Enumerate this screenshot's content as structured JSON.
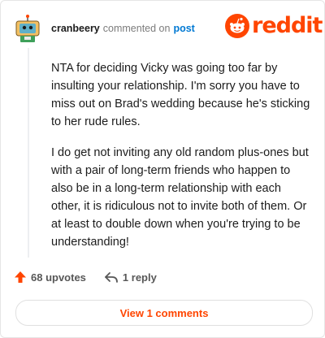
{
  "comment": {
    "username": "cranbeery",
    "action_text": "commented on",
    "post_link": "post",
    "paragraphs": [
      "NTA for deciding Vicky was going too far by insulting your relationship. I'm sorry you have to miss out on Brad's wedding because he's sticking to her rude rules.",
      "I do get not inviting any old random plus-ones but with a pair of long-term friends who happen to also be in a long-term relationship with each other, it is ridiculous not to invite both of them. Or at least to double down when you're trying to be understanding!"
    ]
  },
  "brand": {
    "name": "reddit",
    "color": "#ff4500"
  },
  "actions": {
    "upvotes": "68 upvotes",
    "reply": "1 reply",
    "view_comments": "View 1 comments"
  },
  "icons": [
    "avatar",
    "reddit-snoo-icon",
    "upvote-arrow-icon",
    "reply-arrow-icon"
  ]
}
